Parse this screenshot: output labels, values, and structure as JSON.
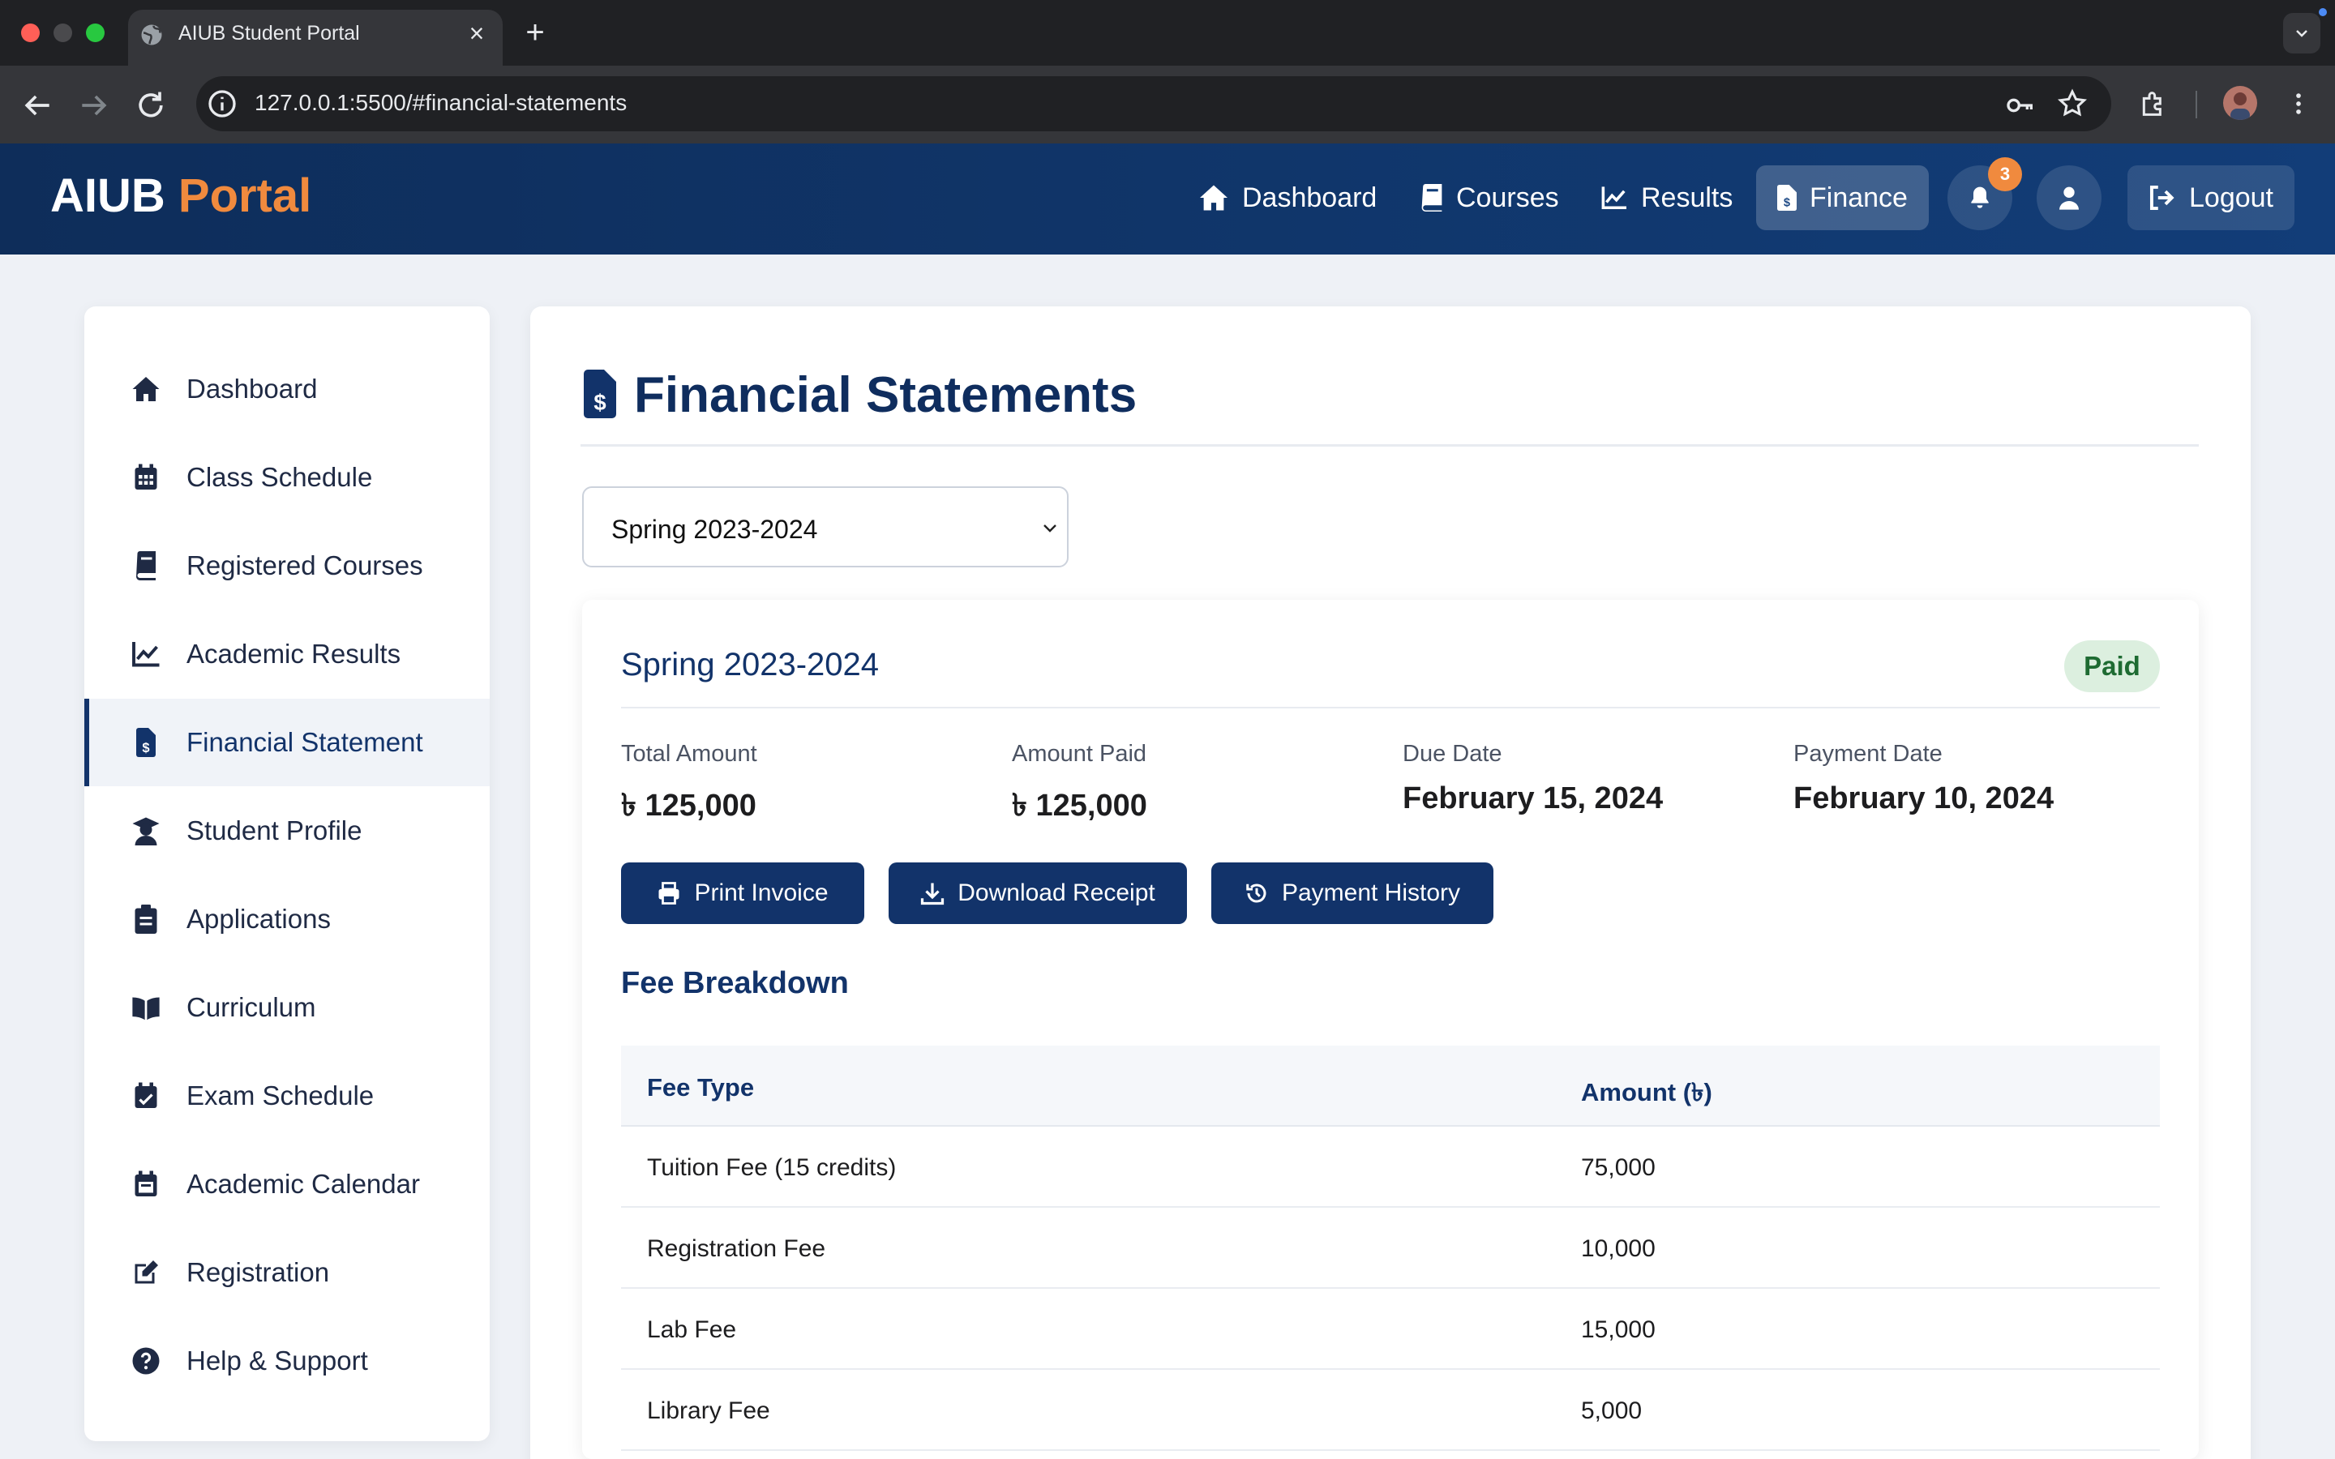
{
  "browser": {
    "tab_title": "AIUB Student Portal",
    "url": "127.0.0.1:5500/#financial-statements"
  },
  "header": {
    "brand_main": "AIUB",
    "brand_accent": "Portal",
    "nav": {
      "dashboard": "Dashboard",
      "courses": "Courses",
      "results": "Results",
      "finance": "Finance",
      "logout": "Logout"
    },
    "notification_count": "3",
    "colors": {
      "header_bg": "#0e2d5a",
      "accent": "#f08a3e"
    }
  },
  "sidebar": {
    "items": [
      {
        "label": "Dashboard",
        "icon": "home-icon"
      },
      {
        "label": "Class Schedule",
        "icon": "calendar-grid-icon"
      },
      {
        "label": "Registered Courses",
        "icon": "book-icon"
      },
      {
        "label": "Academic Results",
        "icon": "line-chart-icon"
      },
      {
        "label": "Financial Statement",
        "icon": "invoice-dollar-icon",
        "active": true
      },
      {
        "label": "Student Profile",
        "icon": "graduate-icon"
      },
      {
        "label": "Applications",
        "icon": "clipboard-icon"
      },
      {
        "label": "Curriculum",
        "icon": "open-book-icon"
      },
      {
        "label": "Exam Schedule",
        "icon": "calendar-check-icon"
      },
      {
        "label": "Academic Calendar",
        "icon": "calendar-icon"
      },
      {
        "label": "Registration",
        "icon": "edit-icon"
      },
      {
        "label": "Help & Support",
        "icon": "question-circle-icon"
      }
    ]
  },
  "main": {
    "page_title": "Financial Statements",
    "term_select": {
      "selected": "Spring 2023-2024"
    },
    "statement": {
      "term": "Spring 2023-2024",
      "status": "Paid",
      "total_amount_label": "Total Amount",
      "total_amount": "৳ 125,000",
      "amount_paid_label": "Amount Paid",
      "amount_paid": "৳ 125,000",
      "due_date_label": "Due Date",
      "due_date": "February 15, 2024",
      "payment_date_label": "Payment Date",
      "payment_date": "February 10, 2024",
      "buttons": {
        "print": "Print Invoice",
        "download": "Download Receipt",
        "history": "Payment History"
      },
      "fee_breakdown_title": "Fee Breakdown",
      "fee_table": {
        "headers": [
          "Fee Type",
          "Amount (৳)"
        ],
        "rows": [
          [
            "Tuition Fee (15 credits)",
            "75,000"
          ],
          [
            "Registration Fee",
            "10,000"
          ],
          [
            "Lab Fee",
            "15,000"
          ],
          [
            "Library Fee",
            "5,000"
          ]
        ]
      }
    }
  }
}
